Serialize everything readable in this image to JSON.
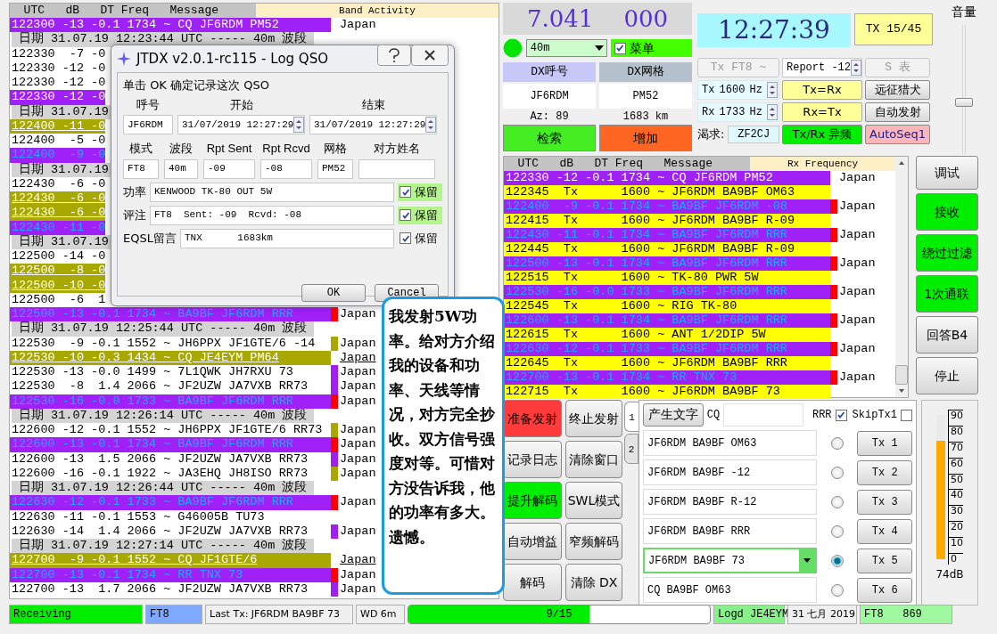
{
  "band_activity": {
    "header": "  UTC   dB   DT Freq   Message",
    "title": "Band Activity",
    "rows": [
      {
        "kind": "dx",
        "text": "122300 -13 -0.1 1734 ~ CQ JF6RDM PM52",
        "country": "Japan"
      },
      {
        "kind": "sep",
        "text": "日期 31.07.19 12:23:44 UTC ----- 40m 波段"
      },
      {
        "kind": "plain",
        "text": "122330  -7 -0"
      },
      {
        "kind": "plain",
        "text": "122330 -12 -0"
      },
      {
        "kind": "plain",
        "text": "122330 -12 -0"
      },
      {
        "kind": "dx",
        "text": "122330 -12 -0"
      },
      {
        "kind": "sep",
        "text": "日期 31.07.19"
      },
      {
        "kind": "cq",
        "text": "122400 -11 -0"
      },
      {
        "kind": "plain",
        "text": "122400  -5 -0"
      },
      {
        "kind": "to_me",
        "text": "122400  -9 -0"
      },
      {
        "kind": "sep",
        "text": "日期 31.07.19"
      },
      {
        "kind": "plain",
        "text": "122430  -6 -0"
      },
      {
        "kind": "cq",
        "text": "122430  -6 -0"
      },
      {
        "kind": "cq",
        "text": "122430  -6 -0"
      },
      {
        "kind": "to_me",
        "text": "122430 -11 -0"
      },
      {
        "kind": "sep",
        "text": "日期 31.07.19"
      },
      {
        "kind": "plain",
        "text": "122500 -14 -0"
      },
      {
        "kind": "cq",
        "text": "122500  -8 -0"
      },
      {
        "kind": "cq",
        "text": "122500 -10 -0"
      },
      {
        "kind": "plain",
        "text": "122500  -6  1"
      },
      {
        "kind": "to_me",
        "text": "122500 -13 -0.1 1734 ~ BA9BF JF6RDM RRR",
        "color": "#ff0000",
        "country": "Japan"
      },
      {
        "kind": "sep",
        "text": "日期 31.07.19 12:25:44 UTC ----- 40m 波段"
      },
      {
        "kind": "plain",
        "text": "122530  -9 -0.1 1552 ~ JH6PPX JF1GTE/6 -14",
        "color": "#a8a800",
        "country": "Japan"
      },
      {
        "kind": "cq",
        "text": "122530 -10 -0.3 1434 ~ CQ JE4EYM PM64",
        "country": "Japan"
      },
      {
        "kind": "plain",
        "text": "122530 -13 -0.0 1499 ~ 7L1QWK JH7RXU 73",
        "color": "#a020f0",
        "country": "Japan"
      },
      {
        "kind": "plain",
        "text": "122530  -8  1.4 2066 ~ JF2UZW JA7VXB RR73",
        "color": "#a020f0",
        "country": "Japan"
      },
      {
        "kind": "to_me",
        "text": "122530 -16 -0.0 1733 ~ BA9BF JF6RDM RRR",
        "color": "#ff0000",
        "country": "Japan"
      },
      {
        "kind": "sep",
        "text": "日期 31.07.19 12:26:14 UTC ----- 40m 波段"
      },
      {
        "kind": "plain",
        "text": "122600 -12 -0.1 1552 ~ JH6PPX JF1GTE/6 RR73",
        "color": "#a8a800",
        "country": "Japan"
      },
      {
        "kind": "to_me",
        "text": "122600 -13 -0.1 1734 ~ BA9BF JF6RDM RRR",
        "color": "#ff0000",
        "country": "Japan"
      },
      {
        "kind": "plain",
        "text": "122600 -13  1.5 2066 ~ JF2UZW JA7VXB RR73",
        "color": "#a020f0",
        "country": "Japan"
      },
      {
        "kind": "plain",
        "text": "122600 -16 -0.1 1922 ~ JA3EHQ JH8ISO RR73",
        "color": "#a8a800",
        "country": "Japan"
      },
      {
        "kind": "sep",
        "text": "日期 31.07.19 12:26:44 UTC ----- 40m 波段"
      },
      {
        "kind": "to_me",
        "text": "122630 -12 -0.1 1733 ~ BA9BF JF6RDM RRR",
        "color": "#ff0000",
        "country": "Japan"
      },
      {
        "kind": "plain",
        "text": "122630 -11 -0.1 1553 ~ G46005B TU73"
      },
      {
        "kind": "plain",
        "text": "122630 -14  1.4 2066 ~ JF2UZW JA7VXB RR73",
        "color": "#a020f0",
        "country": "Japan"
      },
      {
        "kind": "sep",
        "text": "日期 31.07.19 12:27:14 UTC ----- 40m 波段"
      },
      {
        "kind": "cq",
        "text": "122700  -9 -0.1 1552 ~ CQ JF1GTE/6",
        "country": "Japan"
      },
      {
        "kind": "to_me",
        "text": "122700 -13 -0.1 1734 ~ RR TNX 73",
        "color": "#ff0000",
        "country": "Japan"
      },
      {
        "kind": "plain",
        "text": "122700 -13  1.7 2066 ~ JF2UZW JA7VXB RR73",
        "color": "#a020f0",
        "country": "Japan"
      }
    ]
  },
  "log_dialog": {
    "title": "JTDX v2.0.1-rc115 - Log QSO",
    "instruction": "单击 OK 确定记录这次 QSO",
    "fields_top": [
      {
        "label": "呼号",
        "value": "JF6RDM",
        "kind": "text"
      },
      {
        "label": "开始",
        "value": "31/07/2019 12:27:29",
        "kind": "spin"
      },
      {
        "label": "结束",
        "value": "31/07/2019 12:27:29",
        "kind": "spin"
      }
    ],
    "fields_mid": [
      {
        "label": "模式",
        "value": "FT8"
      },
      {
        "label": "波段",
        "value": "40m"
      },
      {
        "label": "Rpt Sent",
        "value": "-09"
      },
      {
        "label": "Rpt Rcvd",
        "value": "-08"
      },
      {
        "label": "网格",
        "value": "PM52"
      },
      {
        "label": "对方姓名"
      }
    ],
    "fields_long": [
      {
        "label": "功率",
        "value": "KENWOOD TK-80 OUT 5W",
        "keep": "保留",
        "checked": true,
        "highlighted": true
      },
      {
        "label": "评注",
        "value": "FT8  Sent: -09  Rcvd: -08",
        "keep": "保留",
        "checked": true,
        "highlighted": true
      },
      {
        "label": "EQSL留言",
        "value": "TNX      1683km",
        "keep": "保留",
        "checked": true,
        "highlighted": false
      }
    ],
    "buttons": [
      "OK",
      "Cancel"
    ]
  },
  "note": "我发射5W功率。给对方介绍我的设备和功率、天线等情况，对方完全抄收。双方信号强度对等。可惜对方没告诉我，他的功率有多大。遗憾。",
  "radio": {
    "dial": {
      "mhz": "7.041",
      "khz": "000"
    },
    "band": "40m",
    "menu_toggle": {
      "label": "菜单",
      "checked": true
    },
    "dx_call": {
      "header": "DX呼号",
      "value": "JF6RDM",
      "info": "Az: 89"
    },
    "dx_grid": {
      "header": "DX网格",
      "value": "PM52",
      "info": "1683 km"
    },
    "lookup_button": "检索",
    "add_button": "增加",
    "clock": "12:27:39",
    "tx_period": "TX 15/45",
    "tx_mode_button": {
      "label": "Tx FT8 ~",
      "disabled": true
    },
    "report": "Report -12",
    "s_meter_button": {
      "label": "S 表",
      "disabled": true
    },
    "tx_freq": {
      "label": "Tx",
      "value": "1600",
      "unit": "Hz"
    },
    "rx_freq": {
      "label": "Rx",
      "value": "1733",
      "unit": "Hz"
    },
    "wanted": {
      "label": "渴求:",
      "value": "ZF2CJ"
    },
    "action_buttons": [
      {
        "label": "Tx=Rx",
        "kind": "yellow"
      },
      {
        "label": "远征猎犬",
        "kind": "plain"
      },
      {
        "label": "Rx=Tx",
        "kind": "yellow"
      },
      {
        "label": "自动发射",
        "kind": "plain"
      },
      {
        "label": "Tx/Rx 异频",
        "kind": "green"
      },
      {
        "label": "AutoSeq1",
        "kind": "pink"
      }
    ],
    "volume": {
      "label": "音量",
      "level": 0.4
    }
  },
  "rx_frequency": {
    "header": "  UTC   dB   DT Freq   Message",
    "title": "Rx Frequency",
    "rows": [
      {
        "kind": "dx",
        "text": "122330 -12 -0.1 1734 ~ CQ JF6RDM PM52",
        "country": "Japan"
      },
      {
        "kind": "tx",
        "text": "122345  Tx      1600 ~ JF6RDM BA9BF OM63"
      },
      {
        "kind": "to_me",
        "text": "122400  -9 -0.1 1734 ~ BA9BF JF6RDM -08",
        "color": "#ff0000",
        "country": "Japan"
      },
      {
        "kind": "tx",
        "text": "122415  Tx      1600 ~ JF6RDM BA9BF R-09"
      },
      {
        "kind": "to_me",
        "text": "122430 -11 -0.1 1734 ~ BA9BF JF6RDM RRR",
        "color": "#ff0000",
        "country": "Japan"
      },
      {
        "kind": "tx",
        "text": "122445  Tx      1600 ~ JF6RDM BA9BF R-09"
      },
      {
        "kind": "to_me",
        "text": "122500 -13 -0.1 1734 ~ BA9BF JF6RDM RRR",
        "color": "#ff0000",
        "country": "Japan"
      },
      {
        "kind": "tx",
        "text": "122515  Tx      1600 ~ TK-80 PWR 5W"
      },
      {
        "kind": "to_me",
        "text": "122530 -16 -0.0 1733 ~ BA9BF JF6RDM RRR",
        "color": "#ff0000",
        "country": "Japan"
      },
      {
        "kind": "tx",
        "text": "122545  Tx      1600 ~ RIG TK-80"
      },
      {
        "kind": "to_me",
        "text": "122600 -13 -0.1 1734 ~ BA9BF JF6RDM RRR",
        "color": "#ff0000",
        "country": "Japan"
      },
      {
        "kind": "tx",
        "text": "122615  Tx      1600 ~ ANT 1/2DIP 5W"
      },
      {
        "kind": "to_me",
        "text": "122630 -12 -0.1 1733 ~ BA9BF JF6RDM RRR",
        "color": "#ff0000",
        "country": "Japan"
      },
      {
        "kind": "tx",
        "text": "122645  Tx      1600 ~ JF6RDM BA9BF RRR"
      },
      {
        "kind": "to_me",
        "text": "122700 -13 -0.1 1734 ~ RR TNX 73",
        "color": "#ff0000",
        "country": "Japan"
      },
      {
        "kind": "tx",
        "text": "122715  Tx      1600 ~ JF6RDM BA9BF 73"
      }
    ]
  },
  "side_buttons": [
    {
      "label": "调试",
      "on": false
    },
    {
      "label": "接收",
      "on": true
    },
    {
      "label": "绕过过滤",
      "on": true
    },
    {
      "label": "1次通联",
      "on": true
    },
    {
      "label": "回答B4",
      "on": false
    },
    {
      "label": "停止",
      "on": false
    }
  ],
  "control_buttons": [
    {
      "label": "准备发射",
      "kind": "red"
    },
    {
      "label": "终止发射",
      "kind": "plain"
    },
    {
      "label": "记录日志",
      "kind": "plain"
    },
    {
      "label": "清除窗口",
      "kind": "plain"
    },
    {
      "label": "提升解码",
      "kind": "green"
    },
    {
      "label": "SWL模式",
      "kind": "plain"
    },
    {
      "label": "自动增益",
      "kind": "plain"
    },
    {
      "label": "窄频解码",
      "kind": "plain"
    },
    {
      "label": "解码",
      "kind": "plain"
    },
    {
      "label": "清除 DX",
      "kind": "plain"
    }
  ],
  "message_tabs": [
    {
      "label": "1",
      "selected": true
    },
    {
      "label": "2",
      "selected": false
    }
  ],
  "messages_panel": {
    "generate_button": "产生文字",
    "cq_label": "CQ",
    "rrr": {
      "label": "RRR",
      "checked": true
    },
    "skip_tx1": {
      "label": "SkipTx1",
      "checked": false
    },
    "messages": [
      {
        "text": "JF6RDM BA9BF OM63",
        "selected": false,
        "button": "Tx 1"
      },
      {
        "text": "JF6RDM BA9BF -12",
        "selected": false,
        "button": "Tx 2"
      },
      {
        "text": "JF6RDM BA9BF R-12",
        "selected": false,
        "button": "Tx 3"
      },
      {
        "text": "JF6RDM BA9BF RRR",
        "selected": false,
        "button": "Tx 4"
      },
      {
        "text": "JF6RDM BA9BF 73",
        "selected": true,
        "button": "Tx 5"
      },
      {
        "text": "CQ BA9BF OM63",
        "selected": false,
        "button": "Tx 6"
      }
    ]
  },
  "meter": {
    "scale": [
      "90",
      "80",
      "70",
      "60",
      "50",
      "40",
      "30",
      "20",
      "10",
      "0"
    ],
    "level": 0.82,
    "reading": "74dB"
  },
  "status_bar": {
    "state": "Receiving",
    "mode": "FT8",
    "last_tx": "Last Tx: JF6RDM BA9BF 73",
    "wd": "WD 6m",
    "progress": {
      "text": "9/15",
      "level": 0.6
    },
    "logged": "Logd JE4EYM",
    "date": "31 七月 2019",
    "mode_count": "FT8   869"
  }
}
